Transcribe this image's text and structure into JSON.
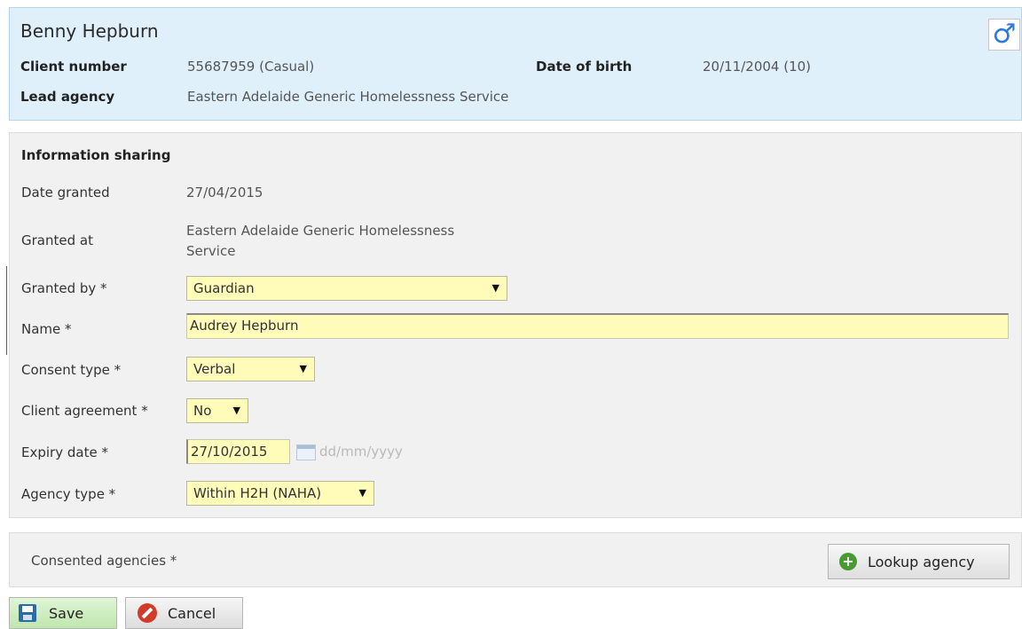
{
  "client": {
    "name": "Benny Hepburn",
    "gender_icon": "male-symbol-icon",
    "gender_symbol": "♂",
    "client_number_label": "Client number",
    "client_number": "55687959 (Casual)",
    "dob_label": "Date of birth",
    "dob": "20/11/2004 (10)",
    "lead_agency_label": "Lead agency",
    "lead_agency": "Eastern Adelaide Generic Homelessness Service"
  },
  "info_sharing": {
    "title": "Information sharing",
    "date_granted_label": "Date granted",
    "date_granted": "27/04/2015",
    "granted_at_label": "Granted at",
    "granted_at_line1": "Eastern Adelaide Generic Homelessness",
    "granted_at_line2": "Service",
    "granted_by_label": "Granted by *",
    "granted_by": "Guardian",
    "name_label": "Name *",
    "name_value": "Audrey Hepburn",
    "consent_type_label": "Consent type *",
    "consent_type": "Verbal",
    "client_agreement_label": "Client agreement *",
    "client_agreement": "No",
    "expiry_date_label": "Expiry date *",
    "expiry_date": "27/10/2015",
    "expiry_date_hint": "dd/mm/yyyy",
    "agency_type_label": "Agency type *",
    "agency_type": "Within H2H (NAHA)",
    "dropdown_arrow": "▼"
  },
  "consented_agencies": {
    "label": "Consented agencies *",
    "lookup_button": "Lookup agency",
    "lookup_icon_symbol": "+"
  },
  "actions": {
    "save_label": "Save",
    "cancel_label": "Cancel"
  },
  "colors": {
    "header_bg": "#dff0fa",
    "field_highlight": "#fffbb8",
    "section_bg": "#f1f1f1",
    "save_green": "#bfe6ad",
    "cancel_red": "#d23a2a"
  }
}
